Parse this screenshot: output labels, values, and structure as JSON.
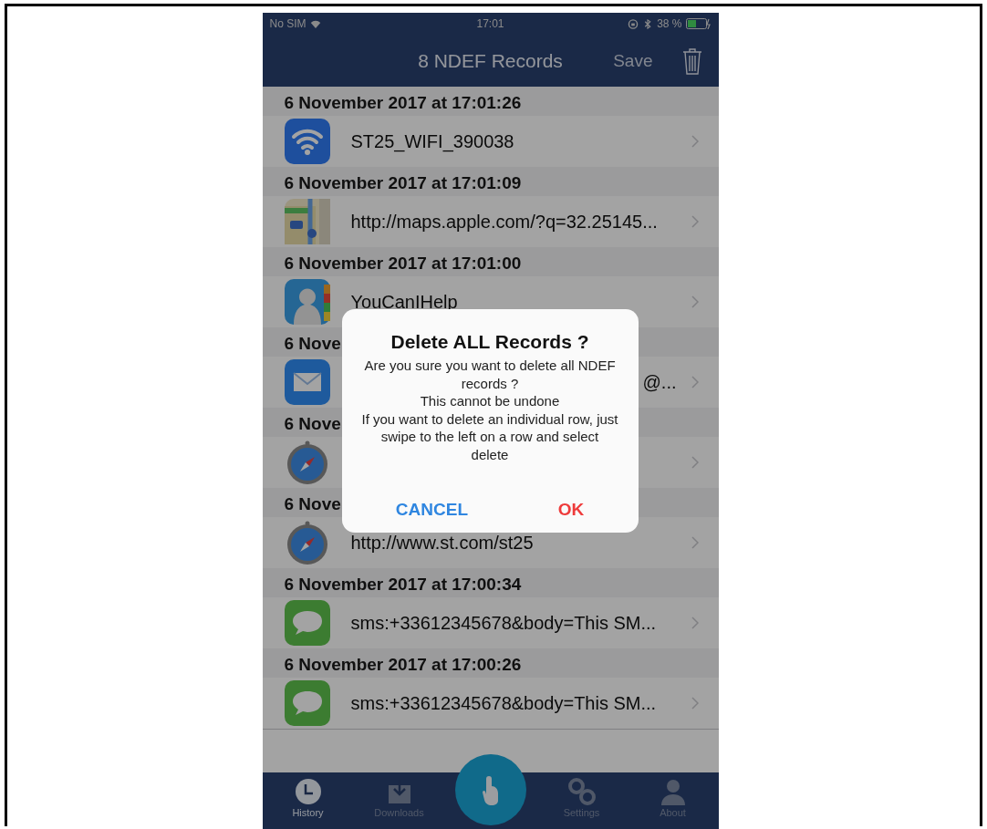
{
  "status_bar": {
    "carrier": "No SIM",
    "time": "17:01",
    "battery": "38 %"
  },
  "nav_bar": {
    "title": "8 NDEF Records",
    "save": "Save"
  },
  "records": [
    {
      "header": "6 November 2017 at 17:01:26",
      "kind": "wifi",
      "value": "ST25_WIFI_390038"
    },
    {
      "header": "6 November 2017 at 17:01:09",
      "kind": "maps",
      "value": "http://maps.apple.com/?q=32.25145..."
    },
    {
      "header": "6 November 2017 at 17:01:00",
      "kind": "contact",
      "value": "YouCanIHelp"
    },
    {
      "header": "6 Nove",
      "kind": "mail",
      "value": "@...",
      "value_tail_only": true
    },
    {
      "header": "6 Nove",
      "kind": "safari"
    },
    {
      "header": "6 Nove",
      "kind": "safari",
      "value": "http://www.st.com/st25"
    },
    {
      "header": "6 November 2017 at 17:00:34",
      "kind": "sms",
      "value": "sms:+33612345678&body=This SM..."
    },
    {
      "header": "6 November 2017 at 17:00:26",
      "kind": "sms",
      "value": "sms:+33612345678&body=This SM..."
    }
  ],
  "dialog": {
    "title": "Delete ALL Records ?",
    "message": "Are you sure you want to delete all NDEF records ?\nThis cannot be undone\nIf you want to delete an individual row, just swipe to the left on a row and select delete",
    "buttons": [
      {
        "label": "CANCEL",
        "kind": "cancel"
      },
      {
        "label": "OK",
        "kind": "destructive"
      }
    ]
  },
  "tab_bar": {
    "tabs": [
      {
        "label": "History",
        "selected": true
      },
      {
        "label": "Downloads",
        "selected": false
      },
      {
        "label": "Settings",
        "selected": false
      },
      {
        "label": "About",
        "selected": false
      }
    ]
  }
}
